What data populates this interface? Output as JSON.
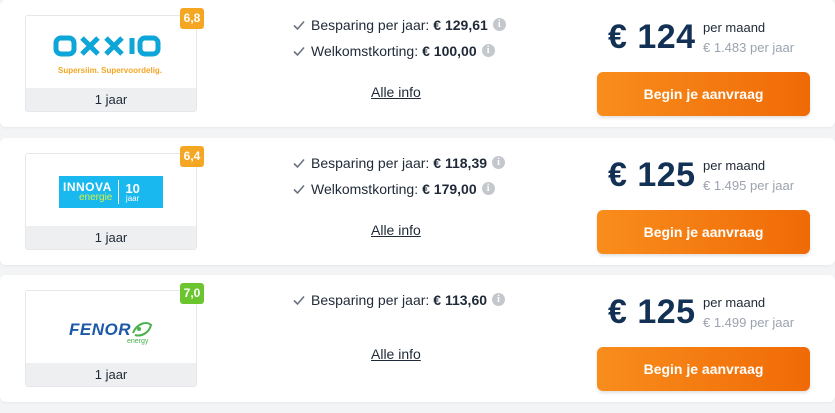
{
  "offers": [
    {
      "provider": "oxxio",
      "logo_text": "oxxio",
      "logo_tagline": "Supersiim. Supervoordelig.",
      "score": "6,8",
      "duration": "1 jaar",
      "benefits": [
        {
          "label": "Besparing per jaar:",
          "value": "€ 129,61"
        },
        {
          "label": "Welkomstkorting:",
          "value": "€ 100,00"
        }
      ],
      "more_info": "Alle info",
      "price": "€ 124",
      "per_month": "per maand",
      "per_year": "€ 1.483 per jaar",
      "cta": "Begin je aanvraag"
    },
    {
      "provider": "innova",
      "logo_text": "INNOVA",
      "logo_sub": "energie",
      "logo_badge_num": "10",
      "logo_badge_sub": "jaar",
      "score": "6,4",
      "duration": "1 jaar",
      "benefits": [
        {
          "label": "Besparing per jaar:",
          "value": "€ 118,39"
        },
        {
          "label": "Welkomstkorting:",
          "value": "€ 179,00"
        }
      ],
      "more_info": "Alle info",
      "price": "€ 125",
      "per_month": "per maand",
      "per_year": "€ 1.495 per jaar",
      "cta": "Begin je aanvraag"
    },
    {
      "provider": "fenor",
      "logo_text": "FENOR",
      "logo_sub": "energy",
      "score": "7,0",
      "duration": "1 jaar",
      "benefits": [
        {
          "label": "Besparing per jaar:",
          "value": "€ 113,60"
        }
      ],
      "more_info": "Alle info",
      "price": "€ 125",
      "per_month": "per maand",
      "per_year": "€ 1.499 per jaar",
      "cta": "Begin je aanvraag"
    }
  ],
  "colors": {
    "price": "#123155",
    "cta_start": "#f88d1c",
    "cta_end": "#f06a06",
    "score_orange": "#f5a623",
    "score_green": "#6ac52e",
    "oxxio_blue": "#0ea5d8",
    "oxxio_tagline": "#f5a623",
    "innova_bg": "#19b8ee",
    "fenor_blue": "#1c5aa8",
    "fenor_green": "#47b24a"
  }
}
